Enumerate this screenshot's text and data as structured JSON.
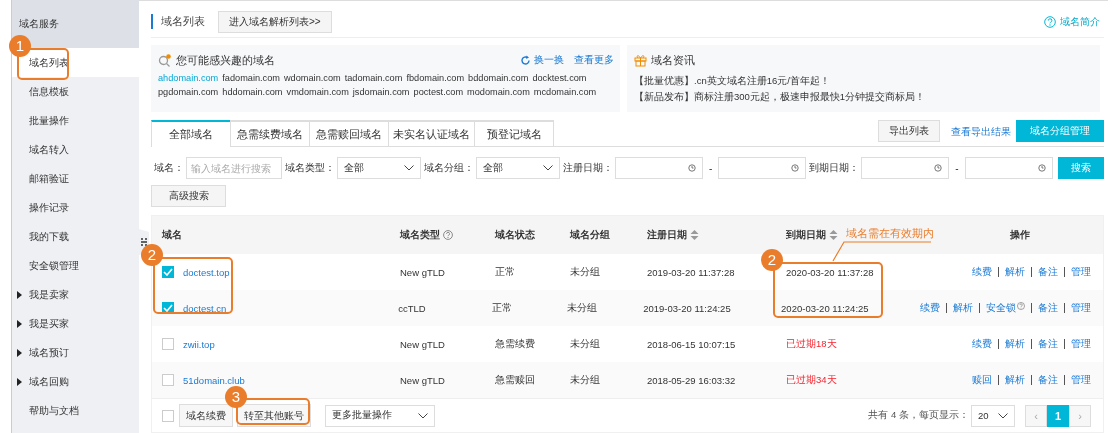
{
  "sidebar": {
    "title": "域名服务",
    "items": [
      {
        "label": "域名列表",
        "selected": true,
        "expandable": false
      },
      {
        "label": "信息模板",
        "selected": false,
        "expandable": false
      },
      {
        "label": "批量操作",
        "selected": false,
        "expandable": false
      },
      {
        "label": "域名转入",
        "selected": false,
        "expandable": false
      },
      {
        "label": "邮箱验证",
        "selected": false,
        "expandable": false
      },
      {
        "label": "操作记录",
        "selected": false,
        "expandable": false
      },
      {
        "label": "我的下载",
        "selected": false,
        "expandable": false
      },
      {
        "label": "安全锁管理",
        "selected": false,
        "expandable": false
      },
      {
        "label": "我是卖家",
        "selected": false,
        "expandable": true
      },
      {
        "label": "我是买家",
        "selected": false,
        "expandable": true
      },
      {
        "label": "域名预订",
        "selected": false,
        "expandable": true
      },
      {
        "label": "域名回购",
        "selected": false,
        "expandable": true
      },
      {
        "label": "帮助与文档",
        "selected": false,
        "expandable": false
      }
    ]
  },
  "header": {
    "title": "域名列表",
    "button": "进入域名解析列表>>",
    "help_link": "域名简介"
  },
  "suggest": {
    "title": "您可能感兴趣的域名",
    "refresh": "换一换",
    "more": "查看更多",
    "domains": [
      {
        "name": "ahdomain.com",
        "highlighted": true
      },
      {
        "name": "fadomain.com",
        "highlighted": false
      },
      {
        "name": "wdomain.com",
        "highlighted": false
      },
      {
        "name": "tadomain.com",
        "highlighted": false
      },
      {
        "name": "fbdomain.com",
        "highlighted": false
      },
      {
        "name": "bddomain.com",
        "highlighted": false
      },
      {
        "name": "docktest.com",
        "highlighted": false
      },
      {
        "name": "pgdomain.com",
        "highlighted": false
      },
      {
        "name": "hddomain.com",
        "highlighted": false
      },
      {
        "name": "vmdomain.com",
        "highlighted": false
      },
      {
        "name": "jsdomain.com",
        "highlighted": false
      },
      {
        "name": "poctest.com",
        "highlighted": false
      },
      {
        "name": "modomain.com",
        "highlighted": false
      },
      {
        "name": "mcdomain.com",
        "highlighted": false
      }
    ]
  },
  "news": {
    "title": "域名资讯",
    "items": [
      "【批量优惠】.cn英文域名注册16元/首年起！",
      "【新品发布】商标注册300元起，极速申报最快1分钟提交商标局！"
    ]
  },
  "tabs": [
    {
      "label": "全部域名",
      "selected": true
    },
    {
      "label": "急需续费域名",
      "selected": false
    },
    {
      "label": "急需赎回域名",
      "selected": false
    },
    {
      "label": "未实名认证域名",
      "selected": false
    },
    {
      "label": "预登记域名",
      "selected": false
    }
  ],
  "toolbar": {
    "export_button": "导出列表",
    "export_link": "查看导出结果",
    "group_button": "域名分组管理"
  },
  "filters": [
    {
      "kind": "text",
      "label": "域名：",
      "placeholder": "输入域名进行搜索"
    },
    {
      "kind": "select",
      "label": "域名类型：",
      "value": "全部"
    },
    {
      "kind": "select",
      "label": "域名分组：",
      "value": "全部"
    },
    {
      "kind": "daterange",
      "label": "注册日期：",
      "separator": "-"
    },
    {
      "kind": "daterange",
      "label": "到期日期：",
      "separator": "-"
    }
  ],
  "search_button": "搜索",
  "advanced_button": "高级搜索",
  "table": {
    "columns": [
      {
        "label": "域名",
        "sortable": false,
        "help": false
      },
      {
        "label": "域名类型",
        "sortable": false,
        "help": true
      },
      {
        "label": "域名状态",
        "sortable": false,
        "help": false
      },
      {
        "label": "域名分组",
        "sortable": false,
        "help": false
      },
      {
        "label": "注册日期",
        "sortable": true,
        "help": false
      },
      {
        "label": "到期日期",
        "sortable": true,
        "help": false
      },
      {
        "label": "操作",
        "sortable": false,
        "help": false
      }
    ],
    "rows": [
      {
        "checked": true,
        "domain": "doctest.top",
        "type": "New gTLD",
        "status": "正常",
        "group": "未分组",
        "registered": "2019-03-20 11:37:28",
        "expires": "2020-03-20 11:37:28",
        "expired": false,
        "actions": [
          {
            "label": "续费",
            "help": false
          },
          {
            "label": "解析",
            "help": false
          },
          {
            "label": "备注",
            "help": false
          },
          {
            "label": "管理",
            "help": false
          }
        ]
      },
      {
        "checked": true,
        "domain": "doctest.cn",
        "type": "ccTLD",
        "status": "正常",
        "group": "未分组",
        "registered": "2019-03-20 11:24:25",
        "expires": "2020-03-20 11:24:25",
        "expired": false,
        "actions": [
          {
            "label": "续费",
            "help": false
          },
          {
            "label": "解析",
            "help": false
          },
          {
            "label": "安全锁",
            "help": true
          },
          {
            "label": "备注",
            "help": false
          },
          {
            "label": "管理",
            "help": false
          }
        ]
      },
      {
        "checked": false,
        "domain": "zwii.top",
        "type": "New gTLD",
        "status": "急需续费",
        "group": "未分组",
        "registered": "2018-06-15 10:07:15",
        "expires": "已过期18天",
        "expired": true,
        "actions": [
          {
            "label": "续费",
            "help": false
          },
          {
            "label": "解析",
            "help": false
          },
          {
            "label": "备注",
            "help": false
          },
          {
            "label": "管理",
            "help": false
          }
        ]
      },
      {
        "checked": false,
        "domain": "51domain.club",
        "type": "New gTLD",
        "status": "急需赎回",
        "group": "未分组",
        "registered": "2018-05-29 16:03:32",
        "expires": "已过期34天",
        "expired": true,
        "actions": [
          {
            "label": "赎回",
            "help": false
          },
          {
            "label": "解析",
            "help": false
          },
          {
            "label": "备注",
            "help": false
          },
          {
            "label": "管理",
            "help": false
          }
        ]
      }
    ]
  },
  "footer": {
    "select_all": false,
    "buttons": [
      "域名续费",
      "转至其他账号"
    ],
    "bulk_select": "更多批量操作",
    "total": "共有 4 条，每页显示：",
    "page_size": "20",
    "prev": "‹",
    "next": "›",
    "pages": [
      {
        "label": "1",
        "selected": true
      }
    ]
  },
  "annotations": [
    {
      "number": "1"
    },
    {
      "number": "2"
    },
    {
      "number": "2",
      "note": "域名需在有效期内"
    },
    {
      "number": "3"
    }
  ]
}
